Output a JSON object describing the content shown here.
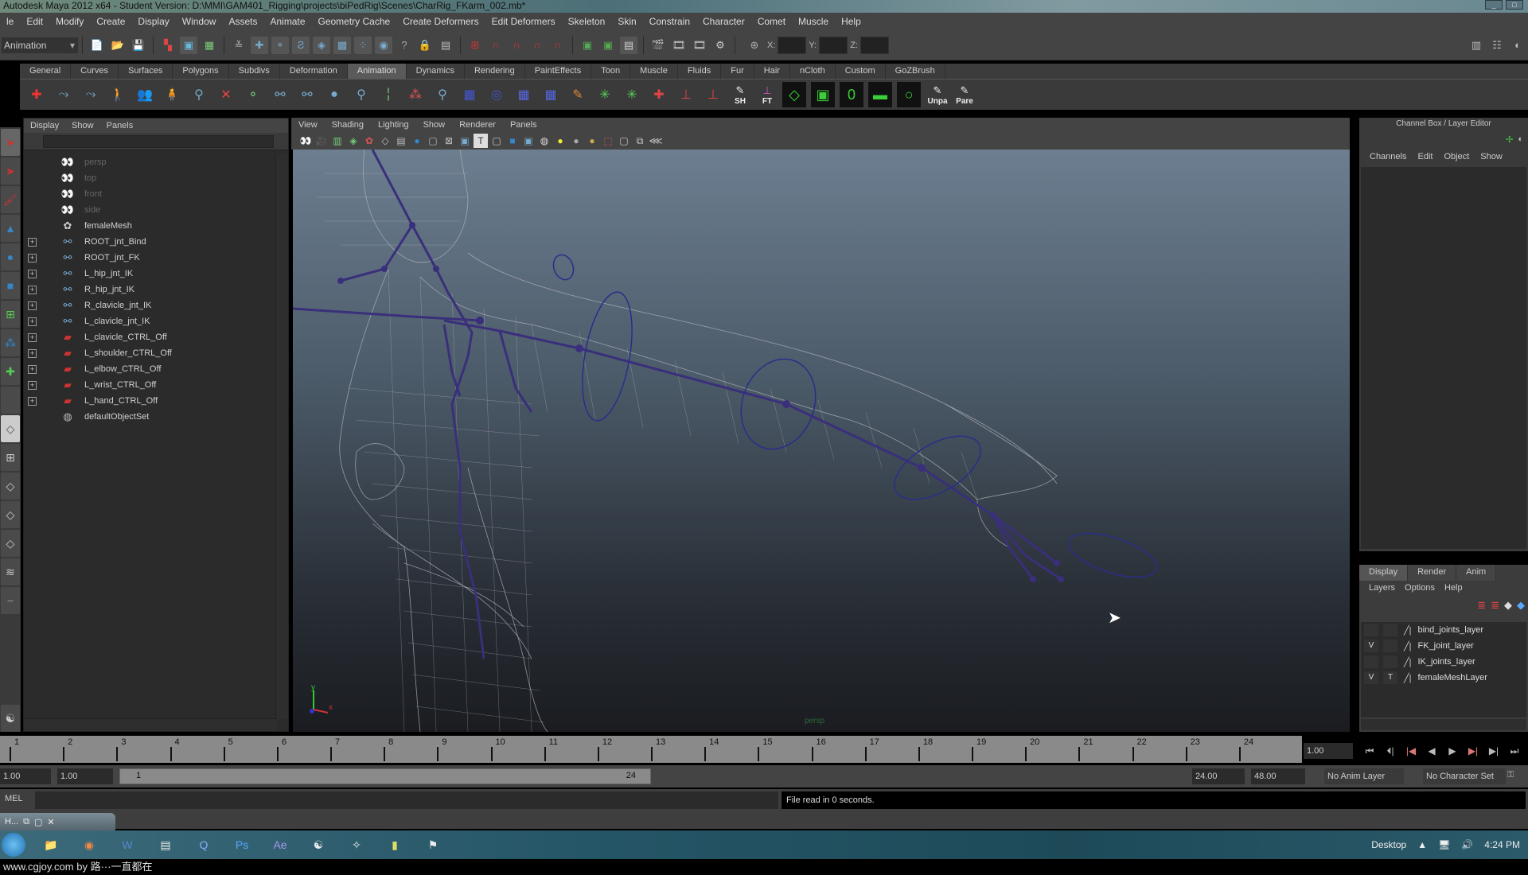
{
  "window": {
    "title": "Autodesk Maya 2012 x64 - Student Version: D:\\MMI\\GAM401_Rigging\\projects\\biPedRig\\Scenes\\CharRig_FKarm_002.mb*"
  },
  "menubar": [
    "le",
    "Edit",
    "Modify",
    "Create",
    "Display",
    "Window",
    "Assets",
    "Animate",
    "Geometry Cache",
    "Create Deformers",
    "Edit Deformers",
    "Skeleton",
    "Skin",
    "Constrain",
    "Character",
    "Comet",
    "Muscle",
    "Help"
  ],
  "statusline": {
    "mode": "Animation",
    "x_label": "X:",
    "y_label": "Y:",
    "z_label": "Z:",
    "x_value": "",
    "y_value": "",
    "z_value": ""
  },
  "shelf": {
    "tabs": [
      "General",
      "Curves",
      "Surfaces",
      "Polygons",
      "Subdivs",
      "Deformation",
      "Animation",
      "Dynamics",
      "Rendering",
      "PaintEffects",
      "Toon",
      "Muscle",
      "Fluids",
      "Fur",
      "Hair",
      "nCloth",
      "Custom",
      "GoZBrush"
    ],
    "active_tab": "Animation",
    "labeled_buttons": [
      "SH",
      "FT",
      "Unpa",
      "Pare"
    ]
  },
  "outliner": {
    "menu": [
      "Display",
      "Show",
      "Panels"
    ],
    "search": "",
    "items": [
      {
        "label": "persp",
        "icon": "camera-icon",
        "dim": true,
        "expandable": false
      },
      {
        "label": "top",
        "icon": "camera-icon",
        "dim": true,
        "expandable": false
      },
      {
        "label": "front",
        "icon": "camera-icon",
        "dim": true,
        "expandable": false
      },
      {
        "label": "side",
        "icon": "camera-icon",
        "dim": true,
        "expandable": false
      },
      {
        "label": "femaleMesh",
        "icon": "mesh-icon",
        "dim": false,
        "expandable": false
      },
      {
        "label": "ROOT_jnt_Bind",
        "icon": "joint-icon",
        "dim": false,
        "expandable": true
      },
      {
        "label": "ROOT_jnt_FK",
        "icon": "joint-icon",
        "dim": false,
        "expandable": true
      },
      {
        "label": "L_hip_jnt_IK",
        "icon": "joint-icon",
        "dim": false,
        "expandable": true
      },
      {
        "label": "R_hip_jnt_IK",
        "icon": "joint-icon",
        "dim": false,
        "expandable": true
      },
      {
        "label": "R_clavicle_jnt_IK",
        "icon": "joint-icon",
        "dim": false,
        "expandable": true
      },
      {
        "label": "L_clavicle_jnt_IK",
        "icon": "joint-icon",
        "dim": false,
        "expandable": true
      },
      {
        "label": "L_clavicle_CTRL_Off",
        "icon": "transform-icon",
        "dim": false,
        "expandable": true
      },
      {
        "label": "L_shoulder_CTRL_Off",
        "icon": "transform-icon",
        "dim": false,
        "expandable": true
      },
      {
        "label": "L_elbow_CTRL_Off",
        "icon": "transform-icon",
        "dim": false,
        "expandable": true
      },
      {
        "label": "L_wrist_CTRL_Off",
        "icon": "transform-icon",
        "dim": false,
        "expandable": true
      },
      {
        "label": "L_hand_CTRL_Off",
        "icon": "transform-icon",
        "dim": false,
        "expandable": true
      },
      {
        "label": "defaultObjectSet",
        "icon": "set-icon",
        "dim": false,
        "expandable": false
      }
    ]
  },
  "viewport": {
    "menu": [
      "View",
      "Shading",
      "Lighting",
      "Show",
      "Renderer",
      "Panels"
    ],
    "camera_label": "persp",
    "axis": {
      "x": "x",
      "y": "y"
    }
  },
  "channelbox": {
    "title": "Channel Box / Layer Editor",
    "menu": [
      "Channels",
      "Edit",
      "Object",
      "Show"
    ]
  },
  "layereditor": {
    "tabs": [
      "Display",
      "Render",
      "Anim"
    ],
    "active_tab": "Display",
    "menu": [
      "Layers",
      "Options",
      "Help"
    ],
    "layers": [
      {
        "v": "",
        "t": "",
        "name": "bind_joints_layer"
      },
      {
        "v": "V",
        "t": "",
        "name": "FK_joint_layer"
      },
      {
        "v": "",
        "t": "",
        "name": "IK_joints_layer"
      },
      {
        "v": "V",
        "t": "T",
        "name": "femaleMeshLayer"
      }
    ]
  },
  "timeline": {
    "ticks": [
      "1",
      "2",
      "3",
      "4",
      "5",
      "6",
      "7",
      "8",
      "9",
      "10",
      "11",
      "12",
      "13",
      "14",
      "15",
      "16",
      "17",
      "18",
      "19",
      "20",
      "21",
      "22",
      "23",
      "24"
    ],
    "current_frame": "1.00"
  },
  "range": {
    "start": "1.00",
    "playback_start": "1.00",
    "slider_start": "1",
    "slider_end": "24",
    "playback_end": "24.00",
    "end": "48.00",
    "anim_layer": "No Anim Layer",
    "character_set": "No Character Set"
  },
  "command": {
    "label": "MEL",
    "input": "",
    "output": "File read in 0 seconds."
  },
  "minimized_window": {
    "label": "H..."
  },
  "taskbar": {
    "tray_label": "Desktop",
    "clock": "4:24 PM"
  },
  "watermark": "www.cgjoy.com by 路···一直都在"
}
